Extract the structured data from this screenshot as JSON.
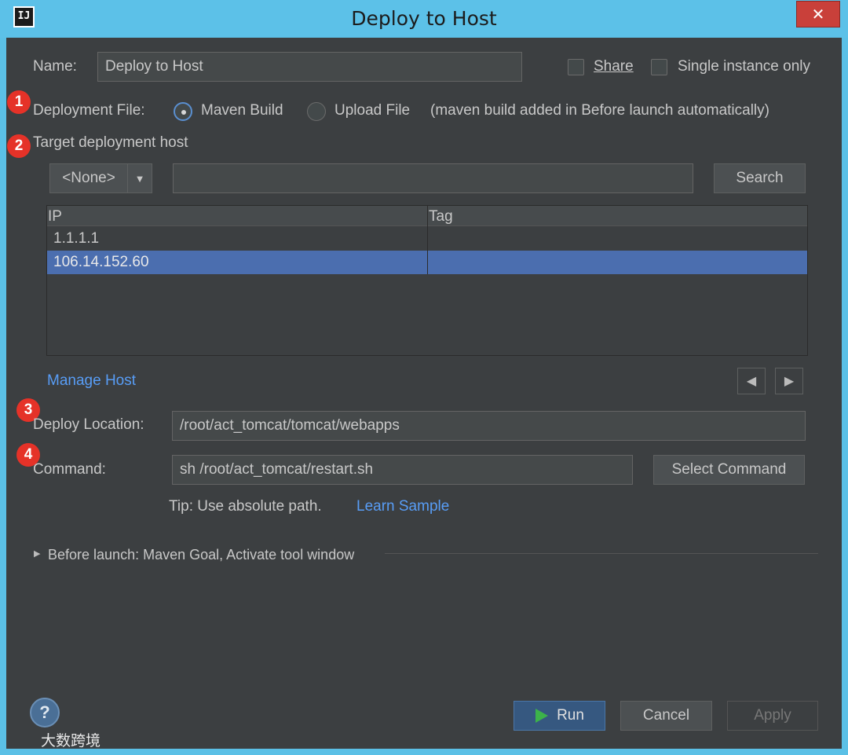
{
  "window": {
    "title": "Deploy to Host",
    "app_icon": "IJ",
    "close_glyph": "✕"
  },
  "name_row": {
    "label": "Name:",
    "value": "Deploy to Host",
    "share_label": "Share",
    "single_instance_label": "Single instance only"
  },
  "deployment_file": {
    "label": "Deployment File:",
    "option_maven": "Maven Build",
    "option_upload": "Upload File",
    "note": "(maven build added in Before launch automatically)",
    "selected": "Maven Build"
  },
  "target_host": {
    "label": "Target deployment host",
    "filter_value": "<None>",
    "search_value": "",
    "search_button": "Search",
    "columns": [
      "IP",
      "Tag"
    ],
    "rows": [
      {
        "ip": "1.1.1.1",
        "tag": "",
        "selected": false
      },
      {
        "ip": "106.14.152.60",
        "tag": "",
        "selected": true
      }
    ],
    "manage_link": "Manage Host"
  },
  "deploy_location": {
    "label": "Deploy Location:",
    "value": "/root/act_tomcat/tomcat/webapps"
  },
  "command": {
    "label": "Command:",
    "value": "sh /root/act_tomcat/restart.sh",
    "select_button": "Select Command"
  },
  "tip": {
    "text": "Tip: Use absolute path.",
    "link": "Learn Sample"
  },
  "before_launch": {
    "text": "Before launch: Maven Goal, Activate tool window"
  },
  "badges": [
    "1",
    "2",
    "3",
    "4"
  ],
  "footer": {
    "help": "?",
    "run": "Run",
    "cancel": "Cancel",
    "apply": "Apply"
  },
  "watermark": "大数跨境",
  "colors": {
    "titlebar": "#5cc1e8",
    "panel": "#3c3f41",
    "selection": "#4b6eaf",
    "link": "#589df6",
    "badge": "#e53228",
    "run_icon": "#3cb34a"
  }
}
